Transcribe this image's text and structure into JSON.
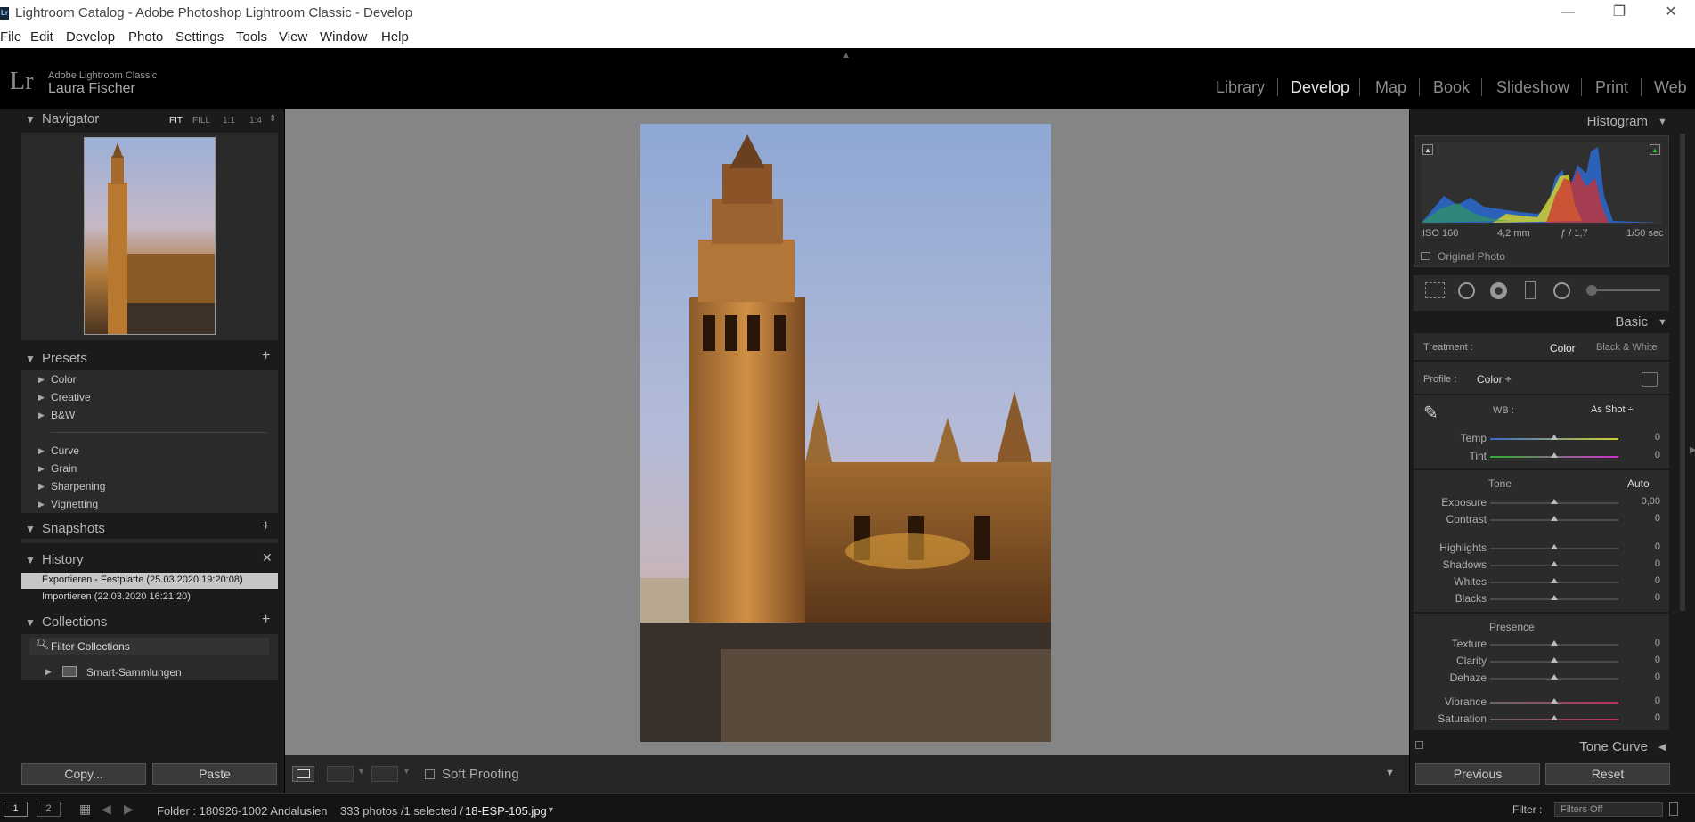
{
  "window": {
    "title": "Lightroom Catalog - Adobe Photoshop Lightroom Classic - Develop",
    "app_icon": "Lr",
    "minimize": "—",
    "restore": "❐",
    "close": "✕"
  },
  "menu": [
    "File",
    "Edit",
    "Develop",
    "Photo",
    "Settings",
    "Tools",
    "View",
    "Window",
    "Help"
  ],
  "identity": {
    "logo": "Lr",
    "product": "Adobe Lightroom Classic",
    "user": "Laura Fischer"
  },
  "modules": [
    "Library",
    "Develop",
    "Map",
    "Book",
    "Slideshow",
    "Print",
    "Web"
  ],
  "active_module": "Develop",
  "navigator": {
    "title": "Navigator",
    "zoom": [
      "FIT",
      "FILL",
      "1:1",
      "1:4"
    ]
  },
  "presets": {
    "title": "Presets",
    "groups_a": [
      "Color",
      "Creative",
      "B&W"
    ],
    "groups_b": [
      "Curve",
      "Grain",
      "Sharpening",
      "Vignetting"
    ]
  },
  "snapshots": {
    "title": "Snapshots"
  },
  "history": {
    "title": "History",
    "items": [
      "Exportieren - Festplatte (25.03.2020 19:20:08)",
      "Importieren (22.03.2020 16:21:20)"
    ]
  },
  "collections": {
    "title": "Collections",
    "filter": "Filter Collections",
    "items": [
      "Smart-Sammlungen"
    ]
  },
  "left_buttons": {
    "copy": "Copy...",
    "paste": "Paste"
  },
  "toolbar": {
    "soft_proofing": "Soft Proofing"
  },
  "histogram": {
    "title": "Histogram",
    "iso": "ISO 160",
    "focal": "4,2 mm",
    "aperture": "ƒ / 1,7",
    "shutter": "1/50 sec",
    "original": "Original Photo"
  },
  "basic": {
    "title": "Basic",
    "treatment_label": "Treatment :",
    "treatment_color": "Color",
    "treatment_bw": "Black & White",
    "profile_label": "Profile :",
    "profile_value": "Color ÷",
    "wb_label": "WB :",
    "wb_value": "As Shot ÷",
    "temp": {
      "label": "Temp",
      "value": "0"
    },
    "tint": {
      "label": "Tint",
      "value": "0"
    },
    "tone_label": "Tone",
    "auto": "Auto",
    "exposure": {
      "label": "Exposure",
      "value": "0,00"
    },
    "contrast": {
      "label": "Contrast",
      "value": "0"
    },
    "highlights": {
      "label": "Highlights",
      "value": "0"
    },
    "shadows": {
      "label": "Shadows",
      "value": "0"
    },
    "whites": {
      "label": "Whites",
      "value": "0"
    },
    "blacks": {
      "label": "Blacks",
      "value": "0"
    },
    "presence_label": "Presence",
    "texture": {
      "label": "Texture",
      "value": "0"
    },
    "clarity": {
      "label": "Clarity",
      "value": "0"
    },
    "dehaze": {
      "label": "Dehaze",
      "value": "0"
    },
    "vibrance": {
      "label": "Vibrance",
      "value": "0"
    },
    "saturation": {
      "label": "Saturation",
      "value": "0"
    }
  },
  "tone_curve": {
    "title": "Tone Curve"
  },
  "right_buttons": {
    "previous": "Previous",
    "reset": "Reset"
  },
  "filmstrip": {
    "page1": "1",
    "page2": "2",
    "folder": "Folder : 180926-1002 Andalusien",
    "count": "333 photos /1 selected /",
    "file": "18-ESP-105.jpg",
    "filter_label": "Filter :",
    "filter_value": "Filters Off"
  }
}
